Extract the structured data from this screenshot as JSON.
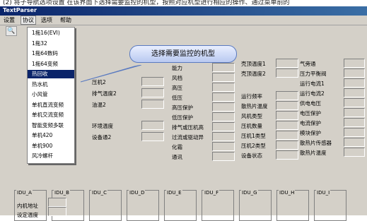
{
  "top_fragment": "(2) 将子导航选项设置 在该界面下选择需要监控的机型，按照对应机型进行相应的操作、通过菜单前的",
  "window": {
    "title": "TextParser"
  },
  "menu": [
    "设置",
    "协议",
    "选项",
    "帮助"
  ],
  "toolbar": {
    "icon": "search-icon"
  },
  "dropdown": {
    "items": [
      "1拖16(EVI)",
      "1拖32",
      "1拖64数码",
      "1拖64变频",
      "热回收",
      "热水机",
      "小风管",
      "单机直流变频",
      "单机交流变频",
      "智能变频多联",
      "单机420",
      "单机900",
      "风冷螺杆"
    ],
    "selected_index": 4
  },
  "tooltip": {
    "text": "选择需要监控的机型"
  },
  "col_left": [
    "压机2",
    "排气温度2",
    "油温2"
  ],
  "col_left2": [
    "环境温度",
    "设备通2"
  ],
  "col_mid": [
    "能力",
    "风档",
    "高压",
    "低压",
    "高压保护",
    "低压保护",
    "排气或压机高",
    "过流或驱动异",
    "化霜",
    "通讯"
  ],
  "col_right1": [
    "壳顶温度1",
    "壳顶温度2",
    "运行频率",
    "散热片温度",
    "风机类型",
    "压机数量",
    "压机1类型",
    "压机2类型",
    "设备状态"
  ],
  "col_right2": [
    "气旁通",
    "压力平衡阀",
    "运行电流1",
    "运行电流2",
    "供电电压",
    "电压保护",
    "电流保护",
    "模块保护",
    "散热片传感器",
    "散热片温度"
  ],
  "idu_labels": [
    "IDU_A",
    "IDU_B",
    "IDU_C",
    "IDU_D",
    "IDU_E",
    "IDU_F",
    "IDU_G",
    "IDU_H",
    "IDU_I"
  ],
  "idu_fields": [
    "内机地址",
    "设定温度"
  ]
}
